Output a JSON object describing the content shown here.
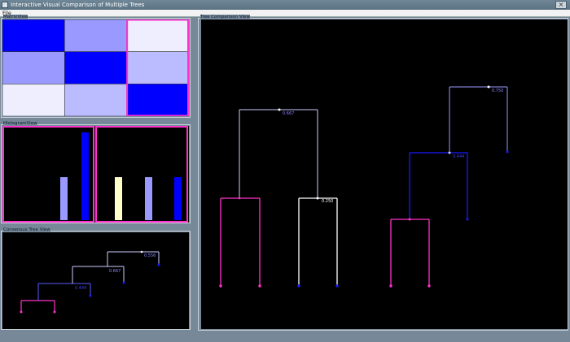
{
  "window": {
    "title": "Interactive Visual Comparison of Multiple Trees",
    "close_glyph": "×"
  },
  "menubar": {
    "file_label": "File"
  },
  "matrix_view": {
    "label": "MatrixView",
    "cells": [
      [
        "#0000ff",
        "#9999ff",
        "#eeeeff"
      ],
      [
        "#9999ff",
        "#0000ff",
        "#bbbbff"
      ],
      [
        "#eeeeff",
        "#bbbbff",
        "#0000ff"
      ]
    ],
    "highlight_color": "#ff33cc"
  },
  "histogram_view": {
    "label": "HistogramView",
    "panels": [
      {
        "bars": [
          {
            "value": 0.49,
            "color": "#9999ff"
          },
          {
            "value": 1.0,
            "color": "#0000ff"
          }
        ]
      },
      {
        "bars": [
          {
            "value": 0.49,
            "color": "#ffffcc"
          },
          {
            "value": 0.49,
            "color": "#9999ff"
          },
          {
            "value": 0.49,
            "color": "#0000ff"
          }
        ]
      }
    ]
  },
  "consensus_tree_view": {
    "label": "Consensus Tree View",
    "node_labels": [
      "0.556",
      "0.667",
      "0.444"
    ]
  },
  "tree_comparison_view": {
    "label": "Tree Comparison View",
    "node_labels": [
      "0.667",
      "0.250",
      "0.750",
      "0.444"
    ]
  },
  "colors": {
    "magenta": "#ff33cc",
    "white": "#ffffff",
    "lavender": "#ccccff",
    "light_blue": "#8888ff",
    "blue": "#0000ee",
    "dark_blue": "#1a1aff"
  }
}
